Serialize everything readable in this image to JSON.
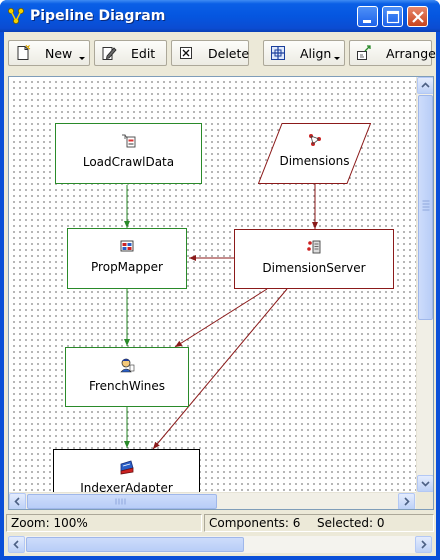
{
  "window": {
    "title": "Pipeline Diagram"
  },
  "toolbar": {
    "new_label": "New",
    "edit_label": "Edit",
    "delete_label": "Delete",
    "align_label": "Align",
    "arrange_label": "Arrange"
  },
  "diagram": {
    "nodes": {
      "load_crawl_data": "LoadCrawlData",
      "dimensions": "Dimensions",
      "prop_mapper": "PropMapper",
      "dimension_server": "DimensionServer",
      "french_wines": "FrenchWines",
      "indexer_adapter": "IndexerAdapter"
    }
  },
  "status": {
    "zoom": "Zoom: 100%",
    "components": "Components: 6",
    "selected": "Selected: 0"
  },
  "colors": {
    "pipeline_green": "#2a8a2a",
    "dimension_red": "#8b1a1a",
    "titlebar_blue": "#0556e0"
  }
}
